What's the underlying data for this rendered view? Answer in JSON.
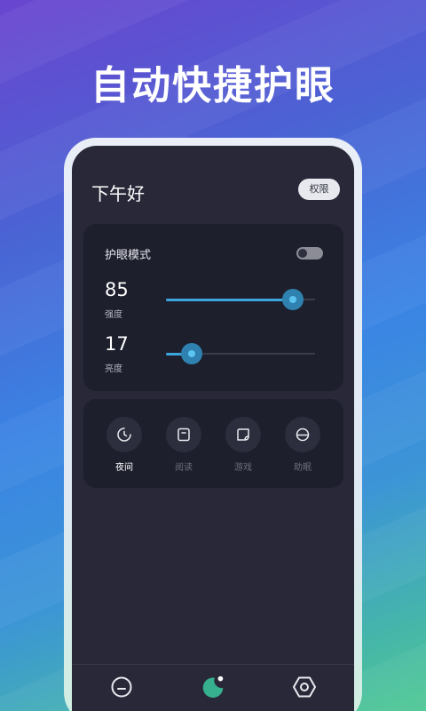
{
  "headline": "自动快捷护眼",
  "header": {
    "greeting": "下午好",
    "permission_label": "权限"
  },
  "eye_mode": {
    "title": "护眼模式",
    "toggle_on": false,
    "intensity": {
      "value": "85",
      "label": "强度",
      "fraction": 0.85
    },
    "brightness": {
      "value": "17",
      "label": "亮度",
      "fraction": 0.17
    }
  },
  "modes": [
    {
      "label": "夜间",
      "icon": "moon-clock-icon",
      "active": true
    },
    {
      "label": "阅读",
      "icon": "book-icon",
      "active": false
    },
    {
      "label": "游戏",
      "icon": "game-icon",
      "active": false
    },
    {
      "label": "助眠",
      "icon": "sleep-icon",
      "active": false
    }
  ],
  "nav": [
    {
      "icon": "minus-circle-icon",
      "active": false
    },
    {
      "icon": "moon-icon",
      "active": true
    },
    {
      "icon": "settings-hex-icon",
      "active": false
    }
  ],
  "colors": {
    "accent": "#3aa6dd",
    "nav_active": "#37b08f"
  }
}
